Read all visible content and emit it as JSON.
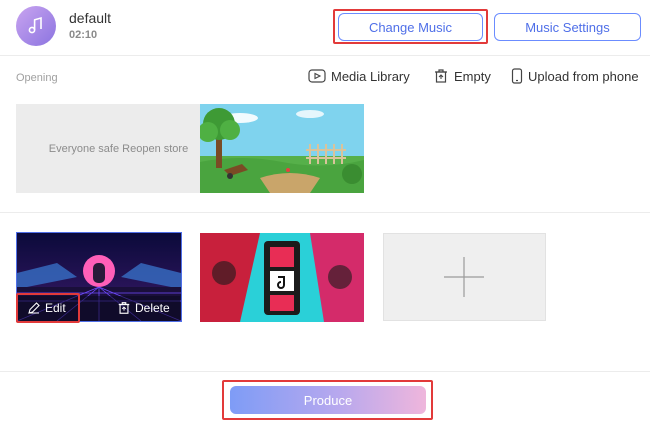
{
  "header": {
    "title": "default",
    "duration": "02:10",
    "change_music_label": "Change Music",
    "music_settings_label": "Music Settings"
  },
  "opening": {
    "label": "Opening",
    "toolbar": {
      "media_library": "Media Library",
      "empty": "Empty",
      "upload_from_phone": "Upload from phone"
    },
    "placeholder_text": "Everyone safe Reopen store"
  },
  "clips": {
    "edit_label": "Edit",
    "delete_label": "Delete"
  },
  "footer": {
    "produce_label": "Produce"
  },
  "icons": {
    "avatar": "music-note-icon",
    "media_library": "media-library-icon",
    "empty": "trash-icon",
    "upload": "phone-icon",
    "edit": "pencil-icon",
    "delete": "trash-icon",
    "add": "plus-icon"
  },
  "colors": {
    "accent": "#4f6fe8",
    "highlight_box": "#e23a3a",
    "produce_gradient_start": "#7e9cf6",
    "produce_gradient_end": "#efb6dc"
  }
}
